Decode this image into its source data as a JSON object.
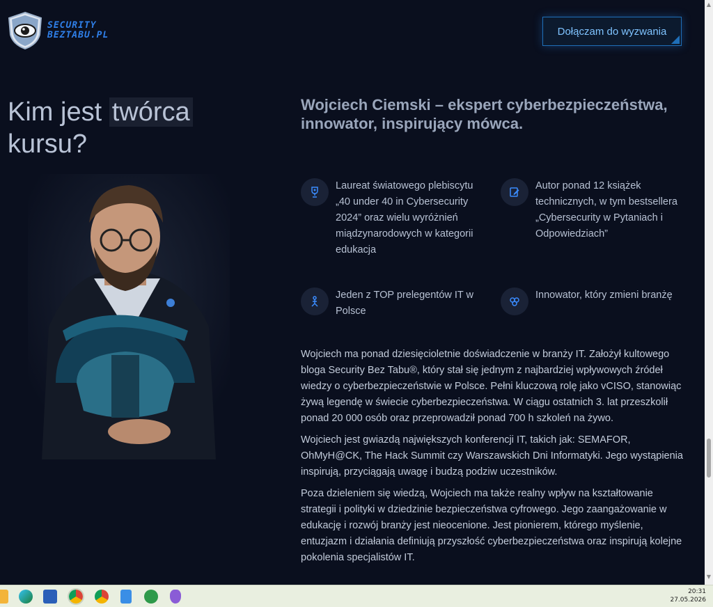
{
  "header": {
    "logo_line1": "SECURITY",
    "logo_line2": "BEZTABU.PL",
    "cta_label": "Dołączam do wyzwania"
  },
  "hero": {
    "heading_part1": "Kim jest ",
    "heading_highlight": "twórca",
    "heading_part2": "kursu?",
    "subheading": "Wojciech Ciemski – ekspert cyberbezpieczeństwa, innowator, inspirujący mówca."
  },
  "features": [
    {
      "icon": "trophy-icon",
      "text": "Laureat światowego plebiscytu „40 under 40 in Cybersecurity 2024” oraz wielu wyróżnień miądzynarodowych w kategorii edukacja"
    },
    {
      "icon": "book-edit-icon",
      "text": "Autor ponad 12 książek technicznych, w tym bestsellera „Cybersecurity w Pytaniach i Odpowiedziach”"
    },
    {
      "icon": "speaker-icon",
      "text": "Jeden z TOP prelegentów IT w Polsce"
    },
    {
      "icon": "innovation-icon",
      "text": "Innowator, który zmieni branżę"
    }
  ],
  "paragraphs": [
    "Wojciech ma ponad dziesięcioletnie doświadczenie w branży IT. Założył kultowego bloga Security Bez Tabu®, który stał się jednym z najbardziej wpływowych źródeł wiedzy o cyberbezpieczeństwie w Polsce. Pełni kluczową rolę jako vCISO, stanowiąc żywą legendę w świecie cyberbezpieczeństwa. W ciągu ostatnich 3. lat przeszkolił ponad 20 000 osób oraz przeprowadził ponad 700 h szkoleń na żywo.",
    "Wojciech jest gwiazdą największych konferencji IT, takich jak: SEMAFOR, OhMyH@CK, The Hack Summit czy Warszawskich Dni Informatyki. Jego wystąpienia inspirują, przyciągają uwagę i budzą podziw uczestników.",
    "Poza dzieleniem się wiedzą, Wojciech ma także realny wpływ na kształtowanie strategii i polityki w dziedzinie bezpieczeństwa cyfrowego. Jego zaangażowanie w edukację i rozwój branży jest nieocenione. Jest pionierem, którego myślenie, entuzjazm i działania definiują przyszłość cyberbezpieczeństwa oraz inspirują kolejne pokolenia specjalistów IT."
  ],
  "taskbar": {
    "time": "20:31",
    "date": "27.05.2026"
  },
  "colors": {
    "background": "#0a0f1e",
    "accent": "#2f7fe8",
    "cta_text": "#7fc3ff"
  }
}
